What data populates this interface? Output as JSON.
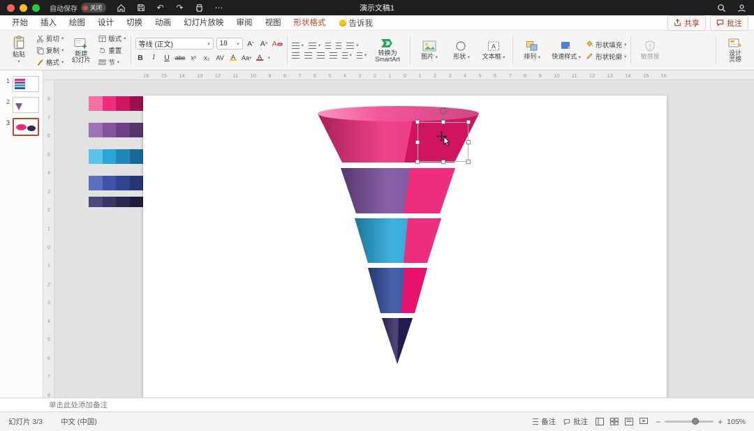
{
  "titlebar": {
    "autosave": "自动保存",
    "autosave_state": "关闭",
    "title": "演示文稿1"
  },
  "menubar": {
    "tabs": [
      {
        "label": "开始",
        "color": "#3b3b3b"
      },
      {
        "label": "插入",
        "color": "#3b3b3b"
      },
      {
        "label": "绘图",
        "color": "#3b3b3b"
      },
      {
        "label": "设计",
        "color": "#3b3b3b"
      },
      {
        "label": "切换",
        "color": "#3b3b3b"
      },
      {
        "label": "动画",
        "color": "#3b3b3b"
      },
      {
        "label": "幻灯片放映",
        "color": "#3b3b3b"
      },
      {
        "label": "审阅",
        "color": "#3b3b3b"
      },
      {
        "label": "视图",
        "color": "#3b3b3b"
      },
      {
        "label": "形状格式",
        "color": "#c5432b"
      }
    ],
    "tell_me": "告诉我",
    "share": "共享",
    "comments": "批注"
  },
  "ribbon": {
    "paste": "粘贴",
    "cut": "剪切",
    "copy": "复制",
    "format_painter": "格式",
    "new_slide_line1": "新建",
    "new_slide_line2": "幻灯片",
    "layout": "版式",
    "reset": "重置",
    "section": "节",
    "font_name": "等线 (正文)",
    "font_size": "18",
    "bold": "B",
    "italic": "I",
    "underline": "U",
    "strike": "abc",
    "superscript": "x²",
    "subscript": "x₂",
    "char_spacing": "AV",
    "highlight": "A",
    "change_case": "Aa",
    "font_color": "A",
    "clear_format": "A",
    "convert_line1": "转换为",
    "convert_line2": "SmartArt",
    "picture": "图片",
    "shapes": "形状",
    "text_box": "文本框",
    "arrange": "排列",
    "quick_styles": "快速样式",
    "shape_fill": "形状填充",
    "shape_outline": "形状轮廓",
    "sensitivity": "敏感度",
    "design_line1": "设计",
    "design_line2": "灵感"
  },
  "slides_panel": {
    "items": [
      {
        "number": "1"
      },
      {
        "number": "2"
      },
      {
        "number": "3"
      }
    ],
    "selected": "3"
  },
  "rulers": {
    "horizontal": [
      "16",
      "15",
      "14",
      "13",
      "12",
      "11",
      "10",
      "9",
      "8",
      "7",
      "6",
      "5",
      "4",
      "3",
      "2",
      "1",
      "0",
      "1",
      "2",
      "3",
      "4",
      "5",
      "6",
      "7",
      "8",
      "9",
      "10",
      "11",
      "12",
      "13",
      "14",
      "15",
      "16"
    ],
    "vertical": [
      "8",
      "7",
      "6",
      "5",
      "4",
      "3",
      "2",
      "1",
      "0",
      "1",
      "2",
      "3",
      "4",
      "5",
      "6",
      "7",
      "8"
    ]
  },
  "palette": {
    "rows": [
      {
        "colors": [
          "#F272A3",
          "#EE2E7D",
          "#CC1763",
          "#99104A"
        ]
      },
      {
        "colors": [
          "#9B72B5",
          "#84539E",
          "#6E4187",
          "#58346D"
        ]
      },
      {
        "colors": [
          "#5BC4E8",
          "#2BA6D9",
          "#1E86B8",
          "#176A93"
        ]
      },
      {
        "colors": [
          "#5A6FBF",
          "#3D53A8",
          "#31438C",
          "#273670"
        ]
      },
      {
        "colors": [
          "#4D4880",
          "#3A3566",
          "#2C284F",
          "#201D3C"
        ]
      }
    ]
  },
  "funnel": {
    "segments": [
      {
        "name": "level-1",
        "front": "#EE2E7D",
        "side": "#D0145F",
        "top": "#F4569B"
      },
      {
        "name": "level-2",
        "front": "#7C4F9E",
        "side": "#EE2E7D"
      },
      {
        "name": "level-3",
        "front": "#29A8D8",
        "side": "#EE2E7D"
      },
      {
        "name": "level-4",
        "front": "#33519F",
        "side": "#E8136D"
      },
      {
        "name": "level-5",
        "front": "#3A2F66",
        "side": "#241C4D"
      }
    ]
  },
  "notes": {
    "placeholder": "单击此处添加备注"
  },
  "statusbar": {
    "slide_counter": "幻灯片 3/3",
    "language": "中文 (中国)",
    "notes_label": "备注",
    "comments_label": "批注",
    "zoom_level": "105%"
  }
}
